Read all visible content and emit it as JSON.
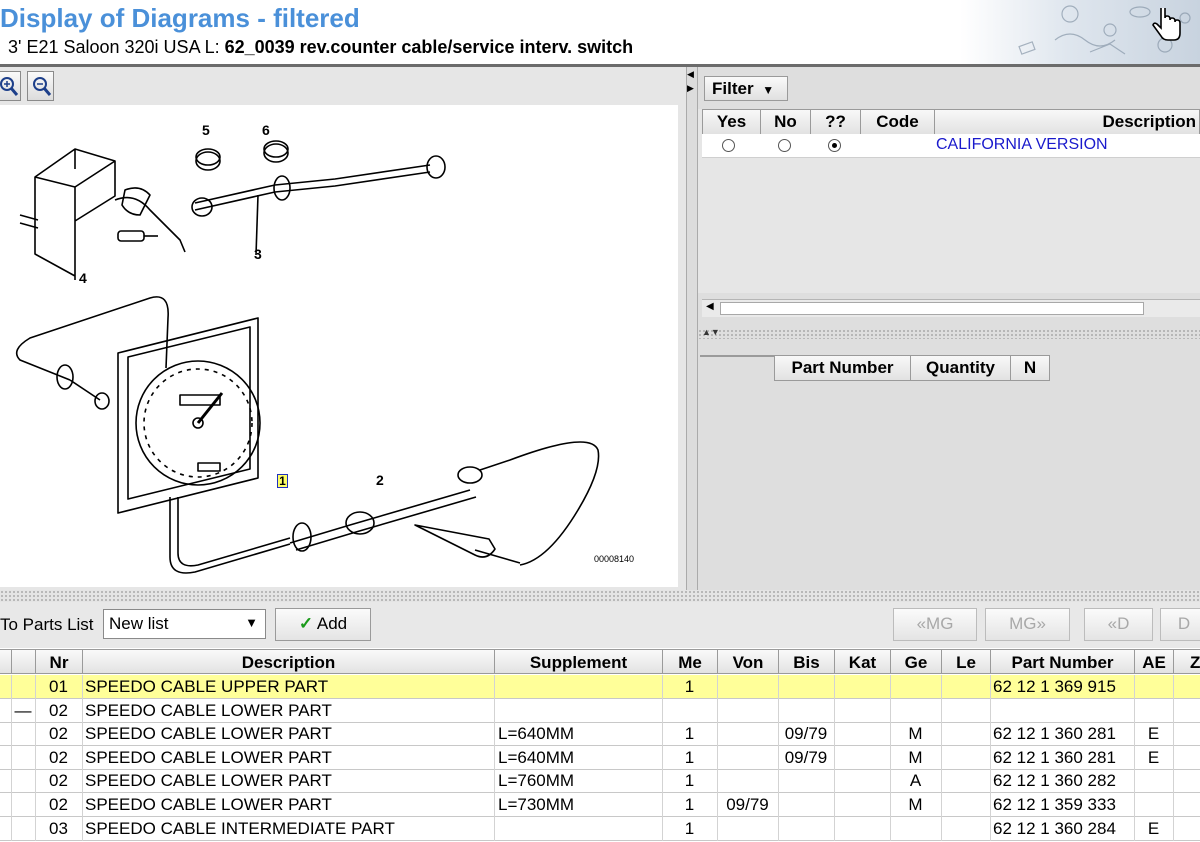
{
  "header": {
    "title": "Display of Diagrams - filtered",
    "vehicle": "3' E21 Saloon 320i USA  L: ",
    "diagram_name": "62_0039 rev.counter cable/service interv. switch"
  },
  "diagram": {
    "labels": [
      "5",
      "6",
      "3",
      "4",
      "1",
      "2"
    ],
    "image_code": "00008140"
  },
  "filter": {
    "button_label": "Filter",
    "columns": [
      "Yes",
      "No",
      "??",
      "Code",
      "Description"
    ],
    "rows": [
      {
        "selected": "??",
        "code": "",
        "description": "CALIFORNIA VERSION"
      }
    ],
    "parts_columns": [
      "Part Number",
      "Quantity",
      "N"
    ]
  },
  "toolbar": {
    "parts_list_label": "To Parts List",
    "list_value": "New list",
    "add_label": "Add",
    "prev_mg": "«MG",
    "next_mg": "MG»",
    "prev_d": "«D",
    "next_d": "D"
  },
  "parts": {
    "columns": [
      "Nr",
      "Description",
      "Supplement",
      "Me",
      "Von",
      "Bis",
      "Kat",
      "Ge",
      "Le",
      "Part Number",
      "AE",
      "Z"
    ],
    "rows": [
      {
        "mark": "",
        "nr": "01",
        "description": "SPEEDO CABLE UPPER PART",
        "supplement": "",
        "me": "1",
        "von": "",
        "bis": "",
        "kat": "",
        "ge": "",
        "le": "",
        "part_number": "62 12 1 369 915",
        "ae": ""
      },
      {
        "mark": "—",
        "nr": "02",
        "description": "SPEEDO CABLE LOWER PART",
        "supplement": "",
        "me": "",
        "von": "",
        "bis": "",
        "kat": "",
        "ge": "",
        "le": "",
        "part_number": "",
        "ae": ""
      },
      {
        "mark": "",
        "nr": "02",
        "description": "SPEEDO CABLE LOWER PART",
        "supplement": "L=640MM",
        "me": "1",
        "von": "",
        "bis": "09/79",
        "kat": "",
        "ge": "M",
        "le": "",
        "part_number": "62 12 1 360 281",
        "ae": "E"
      },
      {
        "mark": "",
        "nr": "02",
        "description": "SPEEDO CABLE LOWER PART",
        "supplement": "L=640MM",
        "me": "1",
        "von": "",
        "bis": "09/79",
        "kat": "",
        "ge": "M",
        "le": "",
        "part_number": "62 12 1 360 281",
        "ae": "E"
      },
      {
        "mark": "",
        "nr": "02",
        "description": "SPEEDO CABLE LOWER PART",
        "supplement": "L=760MM",
        "me": "1",
        "von": "",
        "bis": "",
        "kat": "",
        "ge": "A",
        "le": "",
        "part_number": "62 12 1 360 282",
        "ae": ""
      },
      {
        "mark": "",
        "nr": "02",
        "description": "SPEEDO CABLE LOWER PART",
        "supplement": "L=730MM",
        "me": "1",
        "von": "09/79",
        "bis": "",
        "kat": "",
        "ge": "M",
        "le": "",
        "part_number": "62 12 1 359 333",
        "ae": ""
      },
      {
        "mark": "",
        "nr": "03",
        "description": "SPEEDO CABLE INTERMEDIATE PART",
        "supplement": "",
        "me": "1",
        "von": "",
        "bis": "",
        "kat": "",
        "ge": "",
        "le": "",
        "part_number": "62 12 1 360 284",
        "ae": "E"
      }
    ]
  },
  "colors": {
    "title": "#4a90d9",
    "selected_row": "#ffff99",
    "link": "#1a1acc"
  }
}
